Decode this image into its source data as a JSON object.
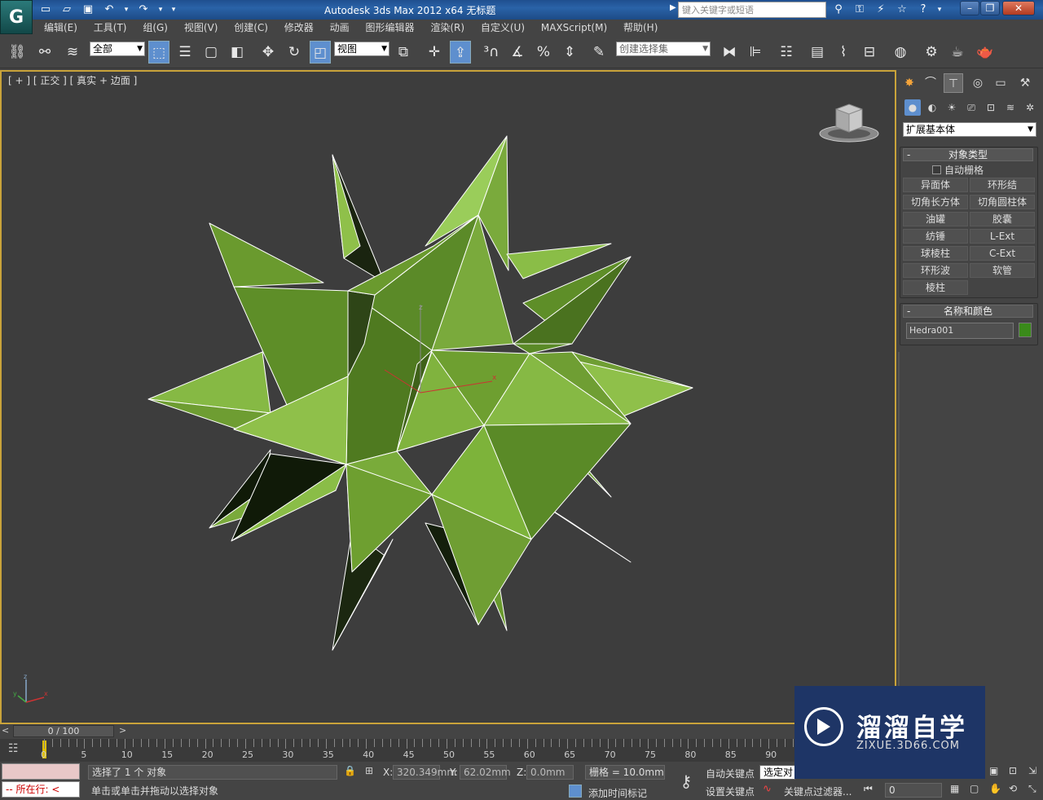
{
  "titlebar": {
    "app_title": "Autodesk 3ds Max  2012 x64       无标题",
    "search_placeholder": "键入关键字或短语",
    "logo": "G"
  },
  "menu": [
    "编辑(E)",
    "工具(T)",
    "组(G)",
    "视图(V)",
    "创建(C)",
    "修改器",
    "动画",
    "图形编辑器",
    "渲染(R)",
    "自定义(U)",
    "MAXScript(M)",
    "帮助(H)"
  ],
  "toolbar": {
    "filter_dropdown": "全部",
    "ref_coord_dropdown": "视图",
    "selection_set_dropdown": "创建选择集"
  },
  "viewport": {
    "label": "[ + ] [ 正交 ] [ 真实 + 边面 ]",
    "object_color": "#7db33a"
  },
  "panel": {
    "primitive_dropdown": "扩展基本体",
    "object_type_header": "对象类型",
    "autogrid_label": "自动栅格",
    "buttons": [
      "异面体",
      "环形结",
      "切角长方体",
      "切角圆柱体",
      "油罐",
      "胶囊",
      "纺锤",
      "L-Ext",
      "球棱柱",
      "C-Ext",
      "环形波",
      "软管",
      "棱柱"
    ],
    "name_color_header": "名称和颜色",
    "object_name": "Hedra001",
    "object_color": "#3a8a1a"
  },
  "timeline": {
    "slider_text": "0 / 100",
    "ticks": [
      "0",
      "5",
      "10",
      "15",
      "20",
      "25",
      "30",
      "35",
      "40",
      "45",
      "50",
      "55",
      "60",
      "65",
      "70",
      "75",
      "80",
      "85",
      "90"
    ]
  },
  "status": {
    "selection_info": "选择了 1 个 对象",
    "prompt": "单击或单击并拖动以选择对象",
    "x_label": "X:",
    "x_value": "320.349mm",
    "y_label": "Y:",
    "y_value": "62.02mm",
    "z_label": "Z:",
    "z_value": "0.0mm",
    "grid": "栅格 = 10.0mm",
    "auto_key": "自动关键点",
    "set_key": "设置关键点",
    "selected_dropdown": "选定对",
    "key_filter": "关键点过滤器...",
    "add_time_tag": "添加时间标记",
    "frame": "0",
    "running": "所在行:"
  },
  "watermark": {
    "title": "溜溜自学",
    "url": "ZIXUE.3D66.COM"
  }
}
